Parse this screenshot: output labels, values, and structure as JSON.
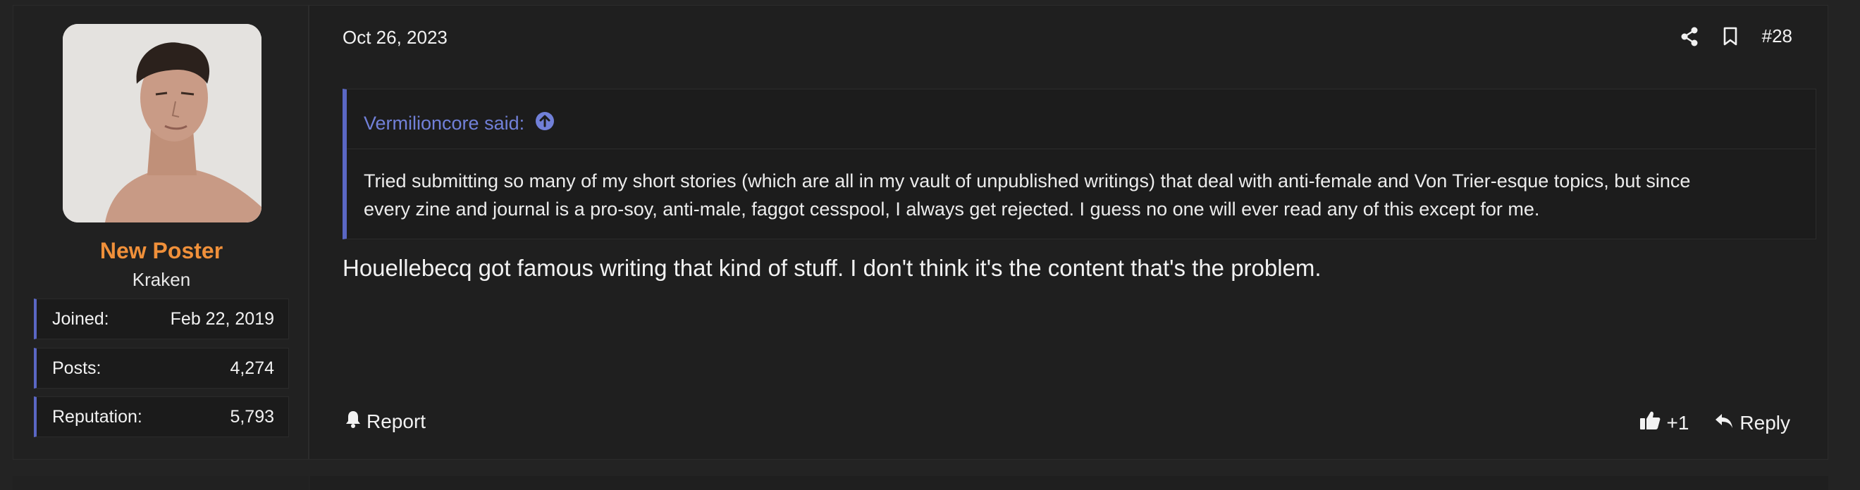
{
  "user": {
    "title": "New Poster",
    "name": "Kraken",
    "stats": [
      {
        "label": "Joined:",
        "value": "Feb 22, 2019"
      },
      {
        "label": "Posts:",
        "value": "4,274"
      },
      {
        "label": "Reputation:",
        "value": "5,793"
      }
    ]
  },
  "post": {
    "date": "Oct 26, 2023",
    "number": "#28",
    "quote": {
      "author": "Vermilioncore said:",
      "lines": [
        "Tried submitting so many of my short stories (which are all in my vault of unpublished writings) that deal with anti-female and Von Trier-esque topics, but since",
        "every zine and journal is a pro-soy, anti-male, faggot cesspool, I always get rejected. I guess no one will ever read any of this except for me."
      ]
    },
    "message": "Houellebecq got famous writing that kind of stuff. I don't think it's the content that's the problem."
  },
  "actions": {
    "report": "Report",
    "like_count": "+1",
    "reply": "Reply"
  },
  "icons": {
    "share": "share-icon",
    "bookmark": "bookmark-icon",
    "quote_jump": "arrow-up-circle-icon",
    "report": "bell-icon",
    "like": "thumbs-up-icon",
    "reply": "reply-arrow-icon"
  },
  "colors": {
    "accent": "#5a67c4",
    "quote_author": "#7180d8",
    "user_title": "#f0903a"
  }
}
